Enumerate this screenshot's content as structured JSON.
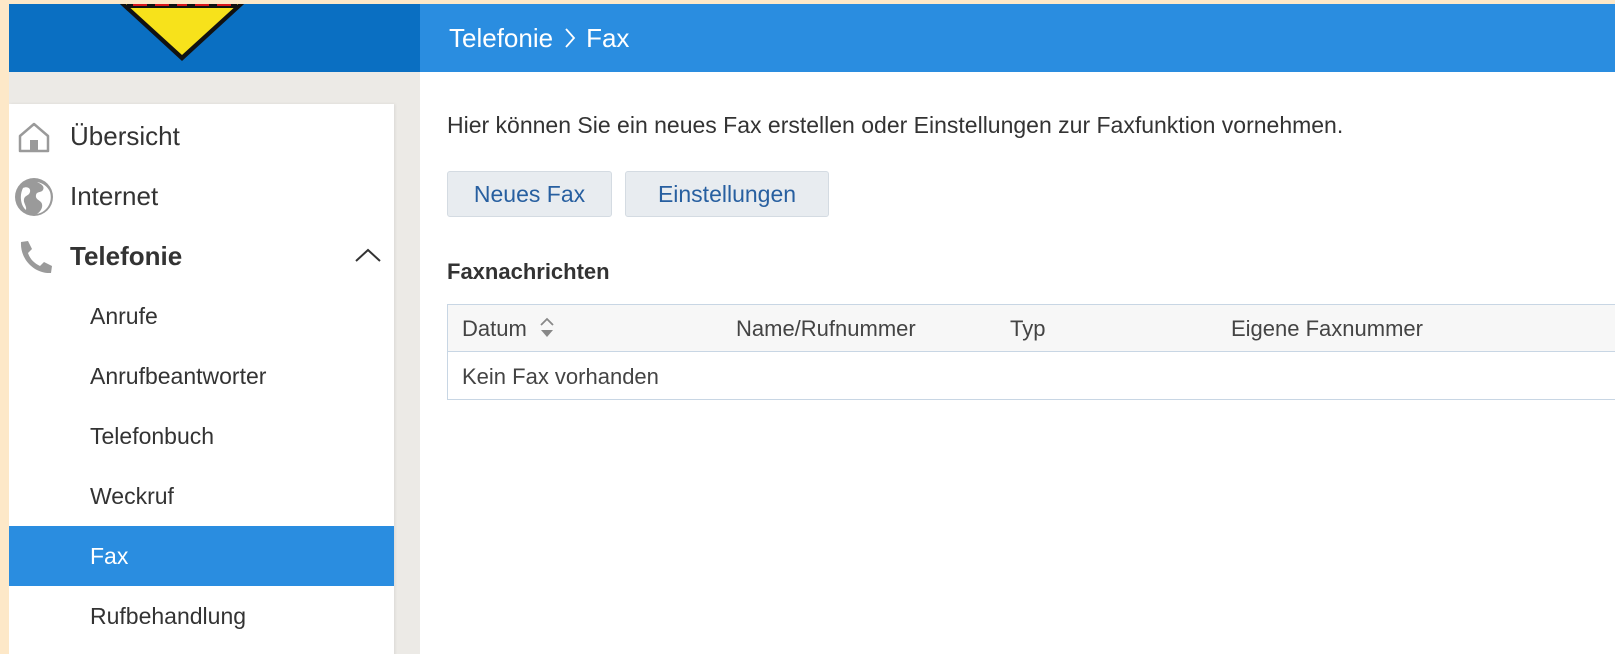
{
  "header": {
    "breadcrumb_section": "Telefonie",
    "breadcrumb_page": "Fax"
  },
  "sidebar": {
    "items": [
      {
        "label": "Übersicht",
        "icon": "home-icon"
      },
      {
        "label": "Internet",
        "icon": "globe-icon"
      },
      {
        "label": "Telefonie",
        "icon": "phone-icon",
        "expanded": true
      }
    ],
    "subitems": [
      {
        "label": "Anrufe"
      },
      {
        "label": "Anrufbeantworter"
      },
      {
        "label": "Telefonbuch"
      },
      {
        "label": "Weckruf"
      },
      {
        "label": "Fax",
        "active": true
      },
      {
        "label": "Rufbehandlung"
      }
    ]
  },
  "main": {
    "intro": "Hier können Sie ein neues Fax erstellen oder Einstellungen zur Faxfunktion vornehmen.",
    "buttons": {
      "new_fax": "Neues Fax",
      "settings": "Einstellungen"
    },
    "section_title": "Faxnachrichten",
    "table": {
      "columns": [
        "Datum",
        "Name/Rufnummer",
        "Typ",
        "Eigene Faxnummer"
      ],
      "empty_text": "Kein Fax vorhanden"
    }
  },
  "colors": {
    "header_blue": "#2a8de0",
    "sidebar_head_blue": "#0a6fc2",
    "active_item": "#2a8de0",
    "button_text": "#275fa0",
    "outer_background": "#fde8c8"
  }
}
